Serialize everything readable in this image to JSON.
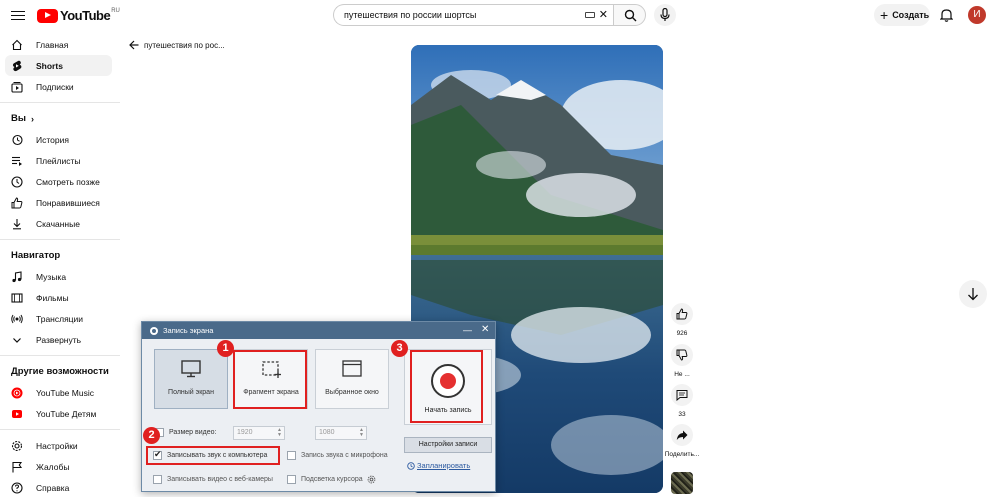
{
  "header": {
    "logo_text": "YouTube",
    "logo_region": "RU",
    "search_value": "путешествия по россии шортсы",
    "create_label": "Создать",
    "avatar_letter": "И"
  },
  "sidebar": {
    "main": [
      {
        "label": "Главная",
        "icon": "home-icon"
      },
      {
        "label": "Shorts",
        "icon": "shorts-icon",
        "active": true
      },
      {
        "label": "Подписки",
        "icon": "subscriptions-icon"
      }
    ],
    "you_title": "Вы",
    "you_items": [
      {
        "label": "История",
        "icon": "history-icon"
      },
      {
        "label": "Плейлисты",
        "icon": "playlists-icon"
      },
      {
        "label": "Смотреть позже",
        "icon": "watch-later-icon"
      },
      {
        "label": "Понравившиеся",
        "icon": "like-icon"
      },
      {
        "label": "Скачанные",
        "icon": "download-icon"
      }
    ],
    "nav_title": "Навигатор",
    "nav_items": [
      {
        "label": "Музыка",
        "icon": "music-icon"
      },
      {
        "label": "Фильмы",
        "icon": "movies-icon"
      },
      {
        "label": "Трансляции",
        "icon": "live-icon"
      },
      {
        "label": "Развернуть",
        "icon": "expand-icon"
      }
    ],
    "more_title": "Другие возможности",
    "more_items": [
      {
        "label": "YouTube Music",
        "icon": "youtube-music-icon"
      },
      {
        "label": "YouTube Детям",
        "icon": "youtube-kids-icon"
      }
    ],
    "bottom_items": [
      {
        "label": "Настройки",
        "icon": "settings-icon"
      },
      {
        "label": "Жалобы",
        "icon": "flag-icon"
      },
      {
        "label": "Справка",
        "icon": "help-icon"
      }
    ]
  },
  "shorts": {
    "back_title": "путешествия по рос...",
    "like_count": "926",
    "dislike_label": "Не ...",
    "comments_count": "33",
    "share_label": "Поделить..."
  },
  "recorder": {
    "title": "Запись экрана",
    "modes": {
      "full": "Полный экран",
      "fragment": "Фрагмент экрана",
      "window": "Выбранное окно"
    },
    "start_label": "Начать запись",
    "settings_label": "Настройки записи",
    "schedule_label": "Запланировать",
    "size_label": "Размер видео:",
    "width_value": "1920",
    "height_value": "1080",
    "opt_system_audio": "Записывать звук с компьютера",
    "opt_mic": "Запись звука с микрофона",
    "opt_webcam": "Записывать видео с веб-камеры",
    "opt_cursor": "Подсветка курсора",
    "badges": [
      "1",
      "2",
      "3"
    ]
  },
  "colors": {
    "brand_red": "#ff0000",
    "highlight_red": "#e02020",
    "dialog_titlebar": "#4a6a8a"
  }
}
